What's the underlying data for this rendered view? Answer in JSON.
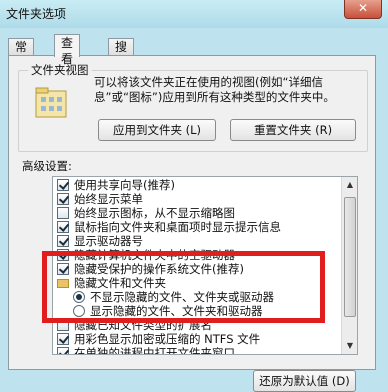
{
  "window": {
    "title": "文件夹选项",
    "close_label": "✕"
  },
  "tabs": [
    {
      "label": "常规",
      "active": false
    },
    {
      "label": "查看",
      "active": true
    },
    {
      "label": "搜索",
      "active": false
    }
  ],
  "folder_view": {
    "group_label": "文件夹视图",
    "description": "可以将该文件夹正在使用的视图(例如“详细信息”或“图标”)应用到所有这种类型的文件夹中。",
    "apply_button": "应用到文件夹 (L)",
    "reset_button": "重置文件夹 (R)"
  },
  "advanced": {
    "label": "高级设置:",
    "items": [
      {
        "type": "checkbox",
        "checked": true,
        "label": "使用共享向导(推荐)"
      },
      {
        "type": "checkbox",
        "checked": true,
        "label": "始终显示菜单"
      },
      {
        "type": "checkbox",
        "checked": false,
        "label": "始终显示图标，从不显示缩略图"
      },
      {
        "type": "checkbox",
        "checked": true,
        "label": "鼠标指向文件夹和桌面项时显示提示信息"
      },
      {
        "type": "checkbox",
        "checked": true,
        "label": "显示驱动器号"
      },
      {
        "type": "checkbox",
        "checked": true,
        "label": "隐藏计算机文件夹中的空驱动器"
      },
      {
        "type": "checkbox",
        "checked": true,
        "label": "隐藏受保护的操作系统文件(推荐)"
      },
      {
        "type": "folder",
        "label": "隐藏文件和文件夹"
      },
      {
        "type": "radio",
        "checked": true,
        "label": "不显示隐藏的文件、文件夹或驱动器"
      },
      {
        "type": "radio",
        "checked": false,
        "label": "显示隐藏的文件、文件夹和驱动器"
      },
      {
        "type": "checkbox",
        "checked": false,
        "label": "隐藏已知文件类型的扩展名"
      },
      {
        "type": "checkbox",
        "checked": true,
        "label": "用彩色显示加密或压缩的 NTFS 文件"
      },
      {
        "type": "checkbox",
        "checked": true,
        "label": "在单独的进程中打开文件夹窗口"
      }
    ],
    "restore_button": "还原为默认值 (D)"
  },
  "colors": {
    "highlight_border": "#e01e1e",
    "titlebar": "#bfe3ee",
    "close_button": "#c8503a"
  }
}
